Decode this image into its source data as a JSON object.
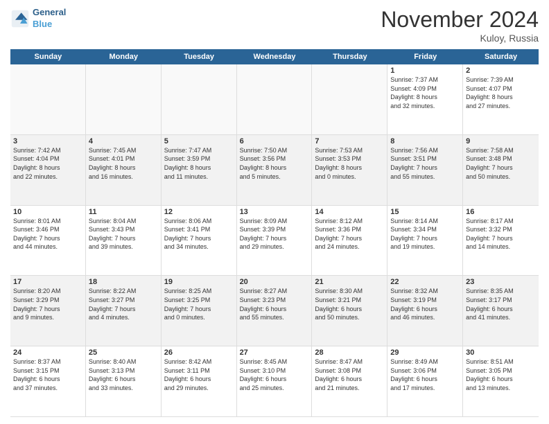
{
  "header": {
    "logo_line1": "General",
    "logo_line2": "Blue",
    "month_title": "November 2024",
    "location": "Kuloy, Russia"
  },
  "days_of_week": [
    "Sunday",
    "Monday",
    "Tuesday",
    "Wednesday",
    "Thursday",
    "Friday",
    "Saturday"
  ],
  "weeks": [
    [
      {
        "day": "",
        "detail": ""
      },
      {
        "day": "",
        "detail": ""
      },
      {
        "day": "",
        "detail": ""
      },
      {
        "day": "",
        "detail": ""
      },
      {
        "day": "",
        "detail": ""
      },
      {
        "day": "1",
        "detail": "Sunrise: 7:37 AM\nSunset: 4:09 PM\nDaylight: 8 hours\nand 32 minutes."
      },
      {
        "day": "2",
        "detail": "Sunrise: 7:39 AM\nSunset: 4:07 PM\nDaylight: 8 hours\nand 27 minutes."
      }
    ],
    [
      {
        "day": "3",
        "detail": "Sunrise: 7:42 AM\nSunset: 4:04 PM\nDaylight: 8 hours\nand 22 minutes."
      },
      {
        "day": "4",
        "detail": "Sunrise: 7:45 AM\nSunset: 4:01 PM\nDaylight: 8 hours\nand 16 minutes."
      },
      {
        "day": "5",
        "detail": "Sunrise: 7:47 AM\nSunset: 3:59 PM\nDaylight: 8 hours\nand 11 minutes."
      },
      {
        "day": "6",
        "detail": "Sunrise: 7:50 AM\nSunset: 3:56 PM\nDaylight: 8 hours\nand 5 minutes."
      },
      {
        "day": "7",
        "detail": "Sunrise: 7:53 AM\nSunset: 3:53 PM\nDaylight: 8 hours\nand 0 minutes."
      },
      {
        "day": "8",
        "detail": "Sunrise: 7:56 AM\nSunset: 3:51 PM\nDaylight: 7 hours\nand 55 minutes."
      },
      {
        "day": "9",
        "detail": "Sunrise: 7:58 AM\nSunset: 3:48 PM\nDaylight: 7 hours\nand 50 minutes."
      }
    ],
    [
      {
        "day": "10",
        "detail": "Sunrise: 8:01 AM\nSunset: 3:46 PM\nDaylight: 7 hours\nand 44 minutes."
      },
      {
        "day": "11",
        "detail": "Sunrise: 8:04 AM\nSunset: 3:43 PM\nDaylight: 7 hours\nand 39 minutes."
      },
      {
        "day": "12",
        "detail": "Sunrise: 8:06 AM\nSunset: 3:41 PM\nDaylight: 7 hours\nand 34 minutes."
      },
      {
        "day": "13",
        "detail": "Sunrise: 8:09 AM\nSunset: 3:39 PM\nDaylight: 7 hours\nand 29 minutes."
      },
      {
        "day": "14",
        "detail": "Sunrise: 8:12 AM\nSunset: 3:36 PM\nDaylight: 7 hours\nand 24 minutes."
      },
      {
        "day": "15",
        "detail": "Sunrise: 8:14 AM\nSunset: 3:34 PM\nDaylight: 7 hours\nand 19 minutes."
      },
      {
        "day": "16",
        "detail": "Sunrise: 8:17 AM\nSunset: 3:32 PM\nDaylight: 7 hours\nand 14 minutes."
      }
    ],
    [
      {
        "day": "17",
        "detail": "Sunrise: 8:20 AM\nSunset: 3:29 PM\nDaylight: 7 hours\nand 9 minutes."
      },
      {
        "day": "18",
        "detail": "Sunrise: 8:22 AM\nSunset: 3:27 PM\nDaylight: 7 hours\nand 4 minutes."
      },
      {
        "day": "19",
        "detail": "Sunrise: 8:25 AM\nSunset: 3:25 PM\nDaylight: 7 hours\nand 0 minutes."
      },
      {
        "day": "20",
        "detail": "Sunrise: 8:27 AM\nSunset: 3:23 PM\nDaylight: 6 hours\nand 55 minutes."
      },
      {
        "day": "21",
        "detail": "Sunrise: 8:30 AM\nSunset: 3:21 PM\nDaylight: 6 hours\nand 50 minutes."
      },
      {
        "day": "22",
        "detail": "Sunrise: 8:32 AM\nSunset: 3:19 PM\nDaylight: 6 hours\nand 46 minutes."
      },
      {
        "day": "23",
        "detail": "Sunrise: 8:35 AM\nSunset: 3:17 PM\nDaylight: 6 hours\nand 41 minutes."
      }
    ],
    [
      {
        "day": "24",
        "detail": "Sunrise: 8:37 AM\nSunset: 3:15 PM\nDaylight: 6 hours\nand 37 minutes."
      },
      {
        "day": "25",
        "detail": "Sunrise: 8:40 AM\nSunset: 3:13 PM\nDaylight: 6 hours\nand 33 minutes."
      },
      {
        "day": "26",
        "detail": "Sunrise: 8:42 AM\nSunset: 3:11 PM\nDaylight: 6 hours\nand 29 minutes."
      },
      {
        "day": "27",
        "detail": "Sunrise: 8:45 AM\nSunset: 3:10 PM\nDaylight: 6 hours\nand 25 minutes."
      },
      {
        "day": "28",
        "detail": "Sunrise: 8:47 AM\nSunset: 3:08 PM\nDaylight: 6 hours\nand 21 minutes."
      },
      {
        "day": "29",
        "detail": "Sunrise: 8:49 AM\nSunset: 3:06 PM\nDaylight: 6 hours\nand 17 minutes."
      },
      {
        "day": "30",
        "detail": "Sunrise: 8:51 AM\nSunset: 3:05 PM\nDaylight: 6 hours\nand 13 minutes."
      }
    ]
  ]
}
